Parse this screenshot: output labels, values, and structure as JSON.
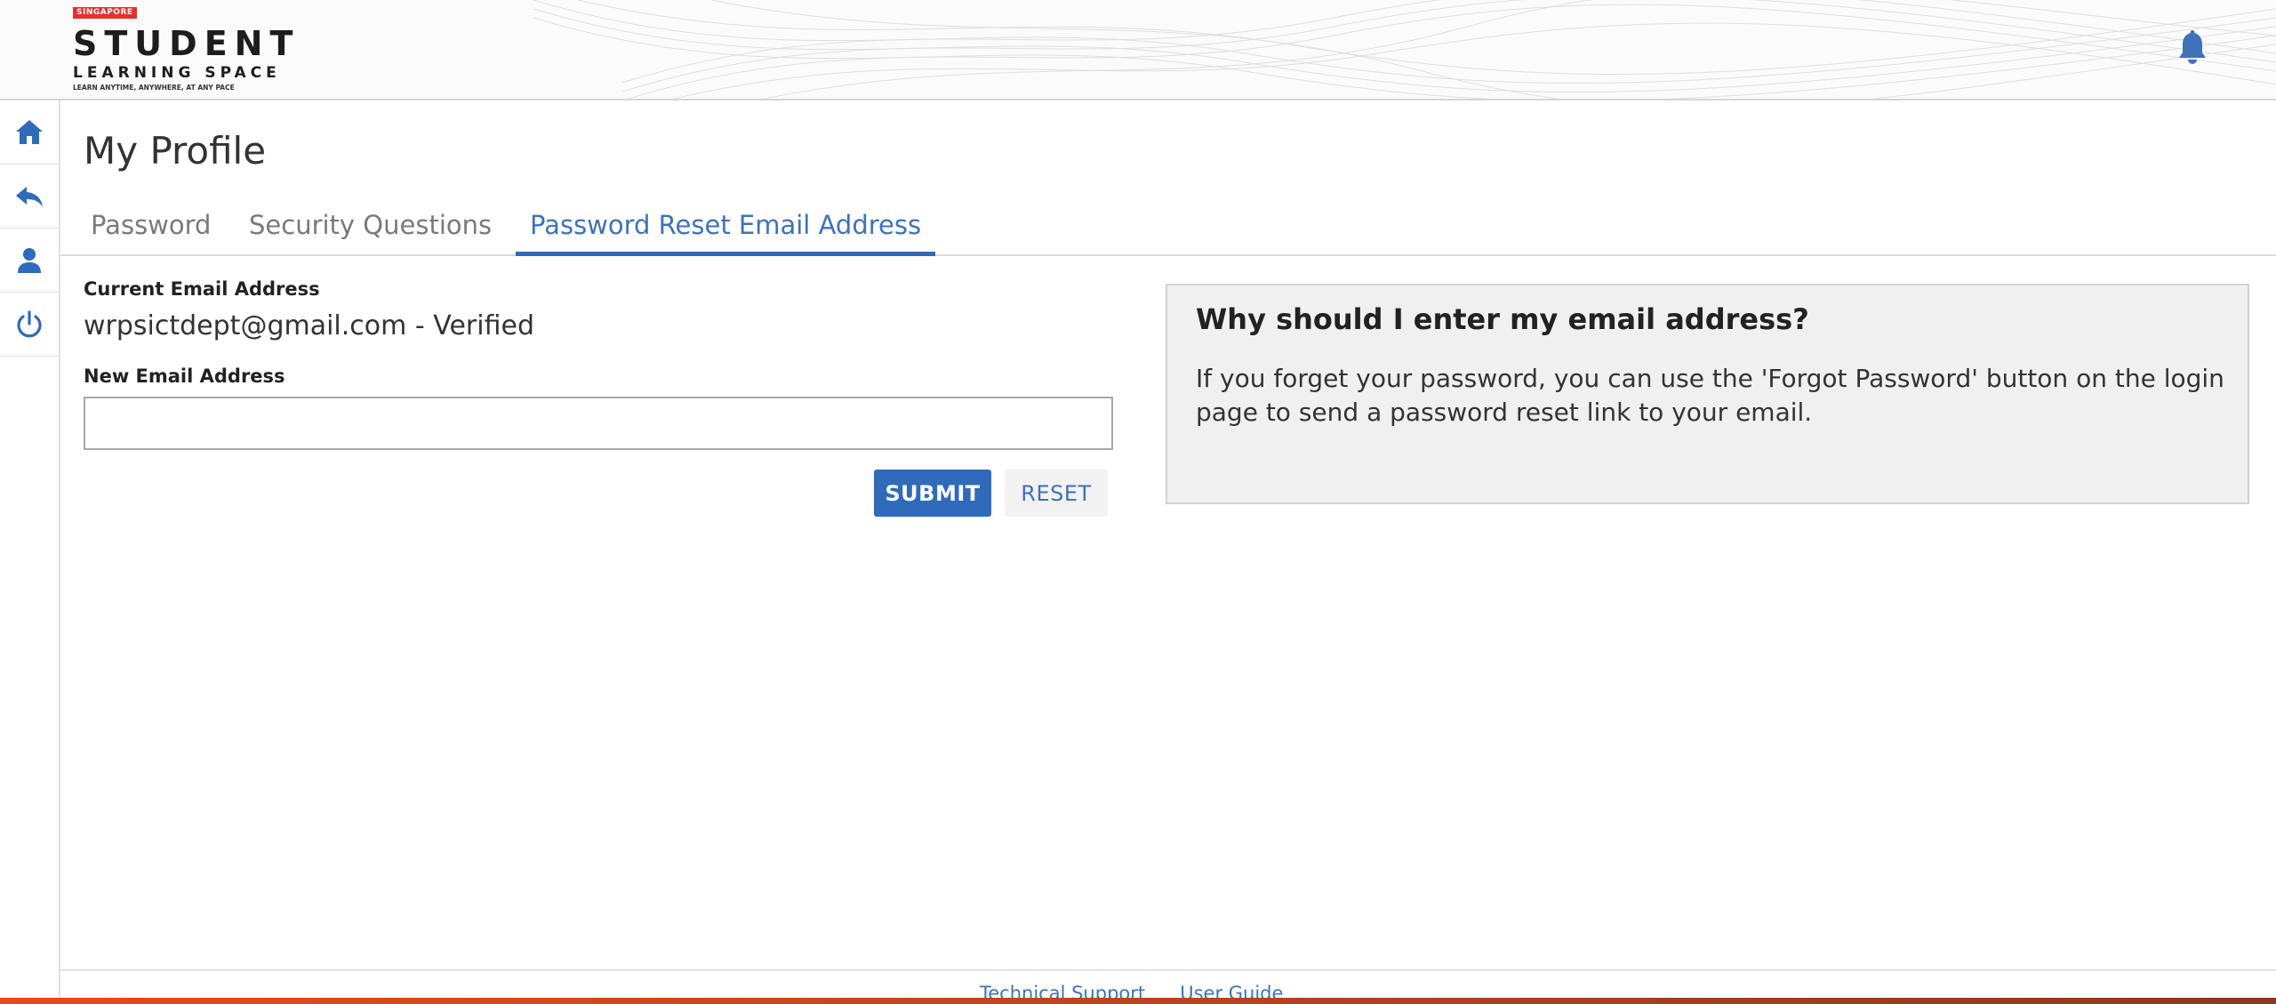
{
  "header": {
    "logo": {
      "tag": "SINGAPORE",
      "word1": "STUDENT",
      "word2": "LEARNING SPACE",
      "tagline": "LEARN ANYTIME, ANYWHERE, AT ANY PACE"
    },
    "notification_icon": "bell-icon"
  },
  "rail": {
    "items": [
      {
        "icon": "home-icon"
      },
      {
        "icon": "reply-icon"
      },
      {
        "icon": "user-icon"
      },
      {
        "icon": "power-icon"
      }
    ]
  },
  "main": {
    "title": "My Profile",
    "tabs": [
      {
        "label": "Password",
        "active": false
      },
      {
        "label": "Security Questions",
        "active": false
      },
      {
        "label": "Password Reset Email Address",
        "active": true
      }
    ],
    "form": {
      "current_label": "Current Email Address",
      "current_value": "wrpsictdept@gmail.com - Verified",
      "new_label": "New Email Address",
      "new_value": "",
      "submit_label": "SUBMIT",
      "reset_label": "RESET"
    },
    "info": {
      "title": "Why should I enter my email address?",
      "body": "If you forget your password, you can use the 'Forgot Password' button on the login page to send a password reset link to your email."
    }
  },
  "footer": {
    "links": [
      "Technical Support",
      "User Guide"
    ]
  },
  "colors": {
    "accent": "#2f6bb8",
    "tab_active": "#3f72b8",
    "logo_tag": "#e2322b",
    "bottom_bar": "#c7451e"
  }
}
